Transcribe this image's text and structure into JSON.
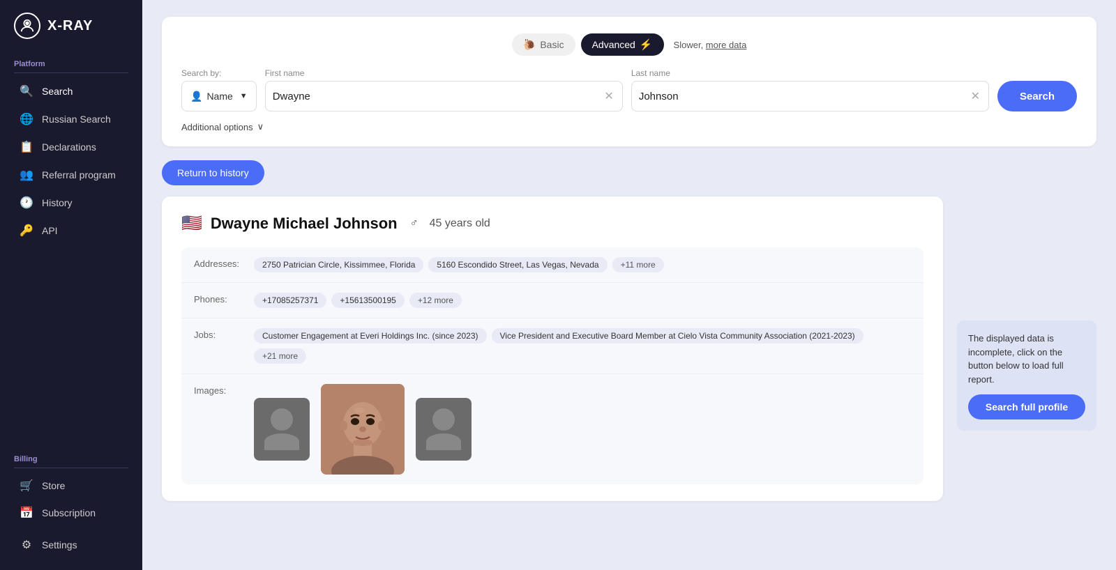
{
  "logo": {
    "icon": "⚙",
    "text": "X-RAY"
  },
  "sidebar": {
    "platform_label": "Platform",
    "billing_label": "Billing",
    "items": [
      {
        "id": "search",
        "label": "Search",
        "icon": "🔍"
      },
      {
        "id": "russian-search",
        "label": "Russian Search",
        "icon": "🌐"
      },
      {
        "id": "declarations",
        "label": "Declarations",
        "icon": "📋"
      },
      {
        "id": "referral",
        "label": "Referral program",
        "icon": "👥"
      },
      {
        "id": "history",
        "label": "History",
        "icon": "🕐"
      },
      {
        "id": "api",
        "label": "API",
        "icon": "🔑"
      }
    ],
    "billing_items": [
      {
        "id": "store",
        "label": "Store",
        "icon": "🛒"
      },
      {
        "id": "subscription",
        "label": "Subscription",
        "icon": "📅"
      }
    ],
    "settings": {
      "label": "Settings",
      "icon": "⚙"
    }
  },
  "mode": {
    "basic_label": "Basic",
    "advanced_label": "Advanced",
    "hint": "Slower, ",
    "hint_link": "more data"
  },
  "search": {
    "search_by_label": "Search by:",
    "name_select_label": "Name",
    "first_name_label": "First name",
    "first_name_value": "Dwayne",
    "last_name_label": "Last name",
    "last_name_value": "Johnson",
    "button_label": "Search",
    "additional_options": "Additional options"
  },
  "return_btn_label": "Return to history",
  "result": {
    "flag": "🇺🇸",
    "name": "Dwayne Michael Johnson",
    "gender": "♂",
    "age": "45 years old",
    "addresses_label": "Addresses:",
    "addresses": [
      "2750 Patrician Circle, Kissimmee, Florida",
      "5160 Escondido Street, Las Vegas, Nevada",
      "+11 more"
    ],
    "phones_label": "Phones:",
    "phones": [
      "+17085257371",
      "+15613500195",
      "+12 more"
    ],
    "jobs_label": "Jobs:",
    "jobs": [
      "Customer Engagement at Everi Holdings Inc. (since 2023)",
      "Vice President and Executive Board Member at Cielo Vista Community Association (2021-2023)",
      "+21 more"
    ],
    "images_label": "Images:"
  },
  "tooltip": {
    "text": "The displayed data is incomplete, click on the button below to load full report.",
    "button_label": "Search full profile"
  }
}
